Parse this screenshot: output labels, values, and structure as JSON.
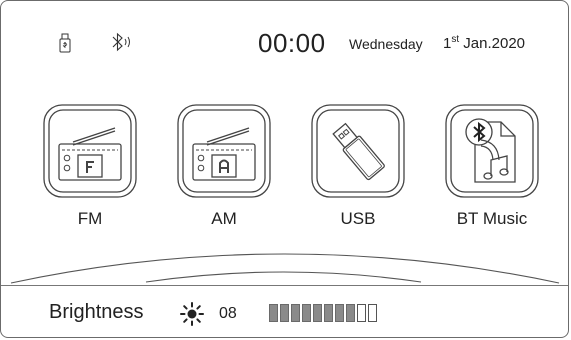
{
  "status": {
    "icons": [
      "usb-stick-icon",
      "bluetooth-icon"
    ],
    "time": "00:00",
    "weekday": "Wednesday",
    "date_day": "1",
    "date_suffix": "st",
    "date_rest": " Jan.2020"
  },
  "apps": [
    {
      "label": "FM",
      "icon": "fm-radio-icon"
    },
    {
      "label": "AM",
      "icon": "am-radio-icon"
    },
    {
      "label": "USB",
      "icon": "usb-drive-icon"
    },
    {
      "label": "BT Music",
      "icon": "bluetooth-music-icon"
    }
  ],
  "brightness": {
    "label": "Brightness",
    "value": "08",
    "level": 8,
    "max": 10,
    "icon": "sun-icon"
  }
}
